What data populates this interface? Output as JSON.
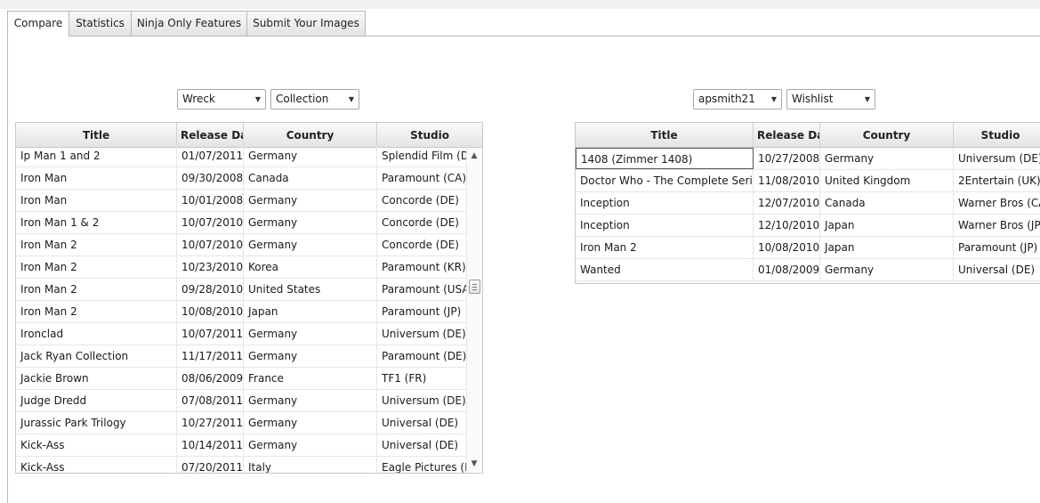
{
  "tabs": [
    {
      "label": "Compare",
      "active": true
    },
    {
      "label": "Statistics",
      "active": false
    },
    {
      "label": "Ninja Only Features",
      "active": false
    },
    {
      "label": "Submit Your Images",
      "active": false
    }
  ],
  "left": {
    "user_select": "Wreck",
    "list_select": "Collection",
    "columns": [
      "Title",
      "Release Date",
      "Country",
      "Studio"
    ],
    "rows": [
      [
        "Ip Man 1 and 2",
        "01/07/2011",
        "Germany",
        "Splendid Film (DE)"
      ],
      [
        "Iron Man",
        "09/30/2008",
        "Canada",
        "Paramount (CA)"
      ],
      [
        "Iron Man",
        "10/01/2008",
        "Germany",
        "Concorde (DE)"
      ],
      [
        "Iron Man 1 & 2",
        "10/07/2010",
        "Germany",
        "Concorde (DE)"
      ],
      [
        "Iron Man 2",
        "10/07/2010",
        "Germany",
        "Concorde (DE)"
      ],
      [
        "Iron Man 2",
        "10/23/2010",
        "Korea",
        "Paramount (KR)"
      ],
      [
        "Iron Man 2",
        "09/28/2010",
        "United States",
        "Paramount (USA)"
      ],
      [
        "Iron Man 2",
        "10/08/2010",
        "Japan",
        "Paramount (JP)"
      ],
      [
        "Ironclad",
        "10/07/2011",
        "Germany",
        "Universum (DE)"
      ],
      [
        "Jack Ryan Collection",
        "11/17/2011",
        "Germany",
        "Paramount (DE)"
      ],
      [
        "Jackie Brown",
        "08/06/2009",
        "France",
        "TF1 (FR)"
      ],
      [
        "Judge Dredd",
        "07/08/2011",
        "Germany",
        "Universum (DE)"
      ],
      [
        "Jurassic Park Trilogy",
        "10/27/2011",
        "Germany",
        "Universal (DE)"
      ],
      [
        "Kick-Ass",
        "10/14/2011",
        "Germany",
        "Universal (DE)"
      ],
      [
        "Kick-Ass",
        "07/20/2011",
        "Italy",
        "Eagle Pictures (IT)"
      ]
    ]
  },
  "right": {
    "user_select": "apsmith21",
    "list_select": "Wishlist",
    "columns": [
      "Title",
      "Release Date",
      "Country",
      "Studio"
    ],
    "rows": [
      [
        "1408 (Zimmer 1408)",
        "10/27/2008",
        "Germany",
        "Universum (DE)"
      ],
      [
        "Doctor Who - The Complete Series",
        "11/08/2010",
        "United Kingdom",
        "2Entertain (UK)"
      ],
      [
        "Inception",
        "12/07/2010",
        "Canada",
        "Warner Bros (CA)"
      ],
      [
        "Inception",
        "12/10/2010",
        "Japan",
        "Warner Bros (JP)"
      ],
      [
        "Iron Man 2",
        "10/08/2010",
        "Japan",
        "Paramount (JP)"
      ],
      [
        "Wanted",
        "01/08/2009",
        "Germany",
        "Universal (DE)"
      ]
    ]
  },
  "icons": {
    "dropdown": "chevron-down-icon",
    "scroll_up": "arrow-up-icon",
    "scroll_down": "arrow-down-icon"
  }
}
